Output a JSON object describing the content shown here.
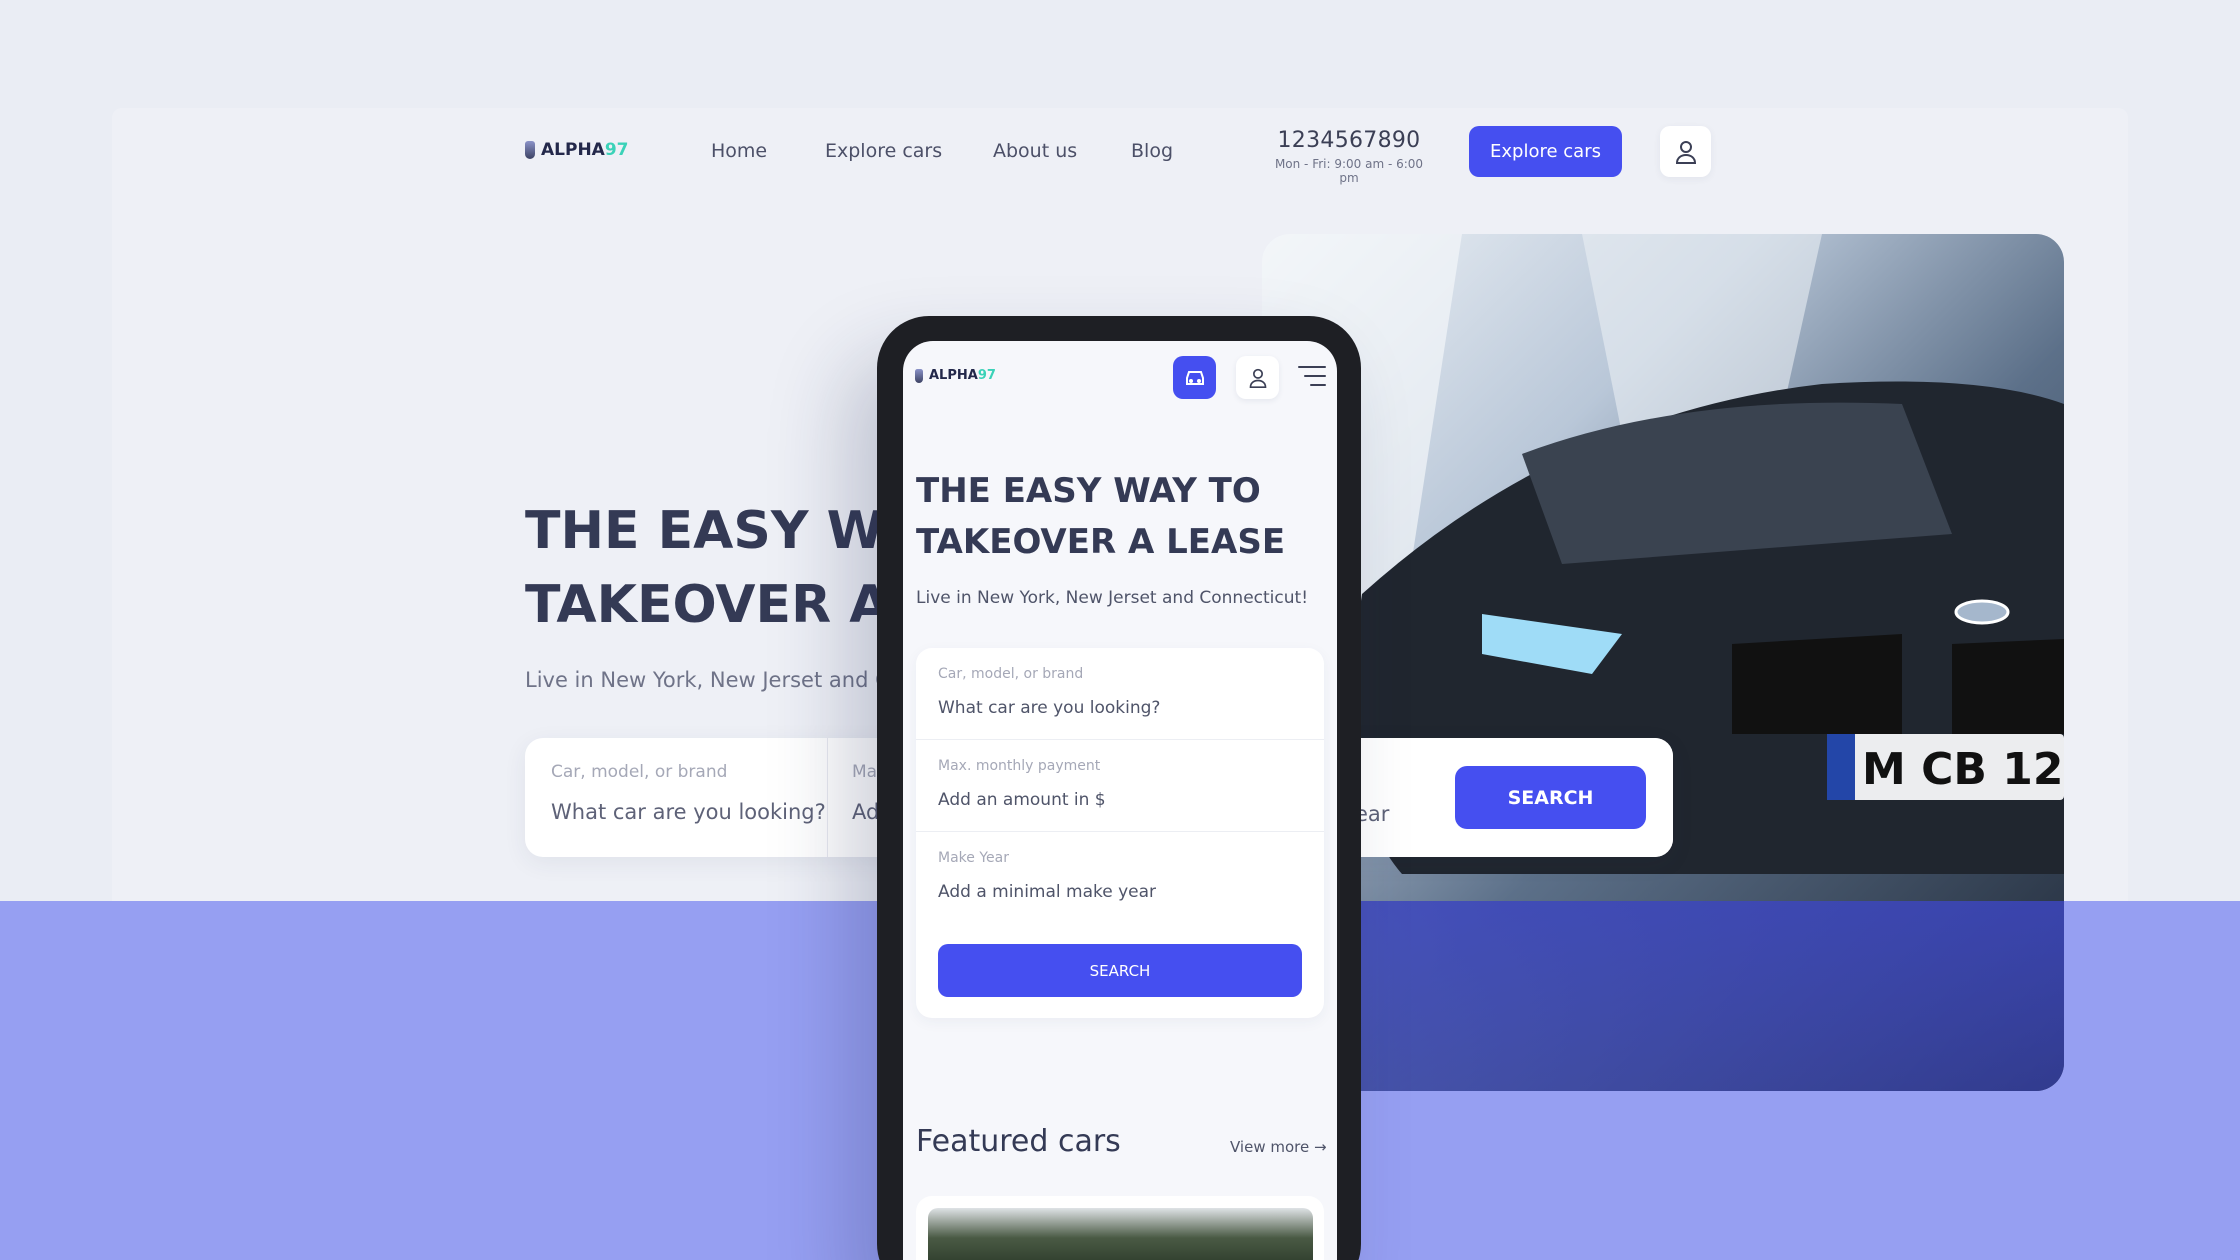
{
  "brand": {
    "name": "ALPHA",
    "suffix": "97"
  },
  "nav": {
    "links": [
      "Home",
      "Explore cars",
      "About us",
      "Blog"
    ],
    "phone": "1234567890",
    "hours": "Mon - Fri: 9:00 am - 6:00 pm",
    "cta_label": "Explore cars"
  },
  "hero": {
    "title_line1": "THE EASY WAY TO",
    "title_line2": "TAKEOVER A LEASE",
    "subtitle": "Live in New York, New Jerset and Connecticut!",
    "search": {
      "field1_label": "Car, model, or brand",
      "field1_value": "What car are you looking?",
      "field2_label": "Max. monthly payment",
      "field2_value": "Add an amount in $",
      "field3_partial": "ear",
      "button_label": "SEARCH"
    }
  },
  "mobile": {
    "title_line1": "THE EASY WAY TO",
    "title_line2": "TAKEOVER A LEASE",
    "subtitle": "Live in New York, New Jerset and Connecticut!",
    "form": {
      "field1_label": "Car, model, or brand",
      "field1_value": "What car are you looking?",
      "field2_label": "Max. monthly payment",
      "field2_value": "Add an amount in $",
      "field3_label": "Make Year",
      "field3_value": "Add a minimal make year",
      "button_label": "SEARCH"
    },
    "featured_title": "Featured cars",
    "view_more": "View more →"
  },
  "colors": {
    "accent": "#454ff0",
    "band": "#969ff2",
    "background": "#eaedf4",
    "logo_suffix": "#3bd2b8"
  }
}
